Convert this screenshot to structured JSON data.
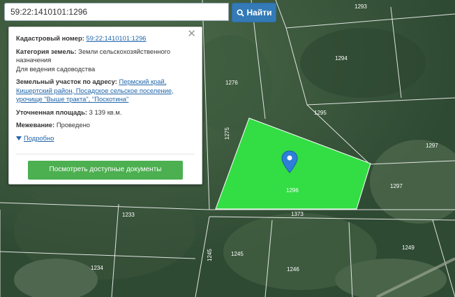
{
  "search": {
    "value": "59:22:1410101:1296",
    "button_label": "Найти"
  },
  "popup": {
    "cadastral_label": "Кадастровый номер:",
    "cadastral_value": "59:22:1410101:1296",
    "category_label": "Категория земель:",
    "category_value": "Земли сельскохозяйственного назначения",
    "usage_value": "Для ведения садоводства",
    "address_label": "Земельный участок по адресу:",
    "address_value": "Пермский край, Кишертский район, Посадское сельское поселение, урочище \"Выше тракта\", \"Поскотина\"",
    "area_label": "Уточненная площадь:",
    "area_value": "3 139 кв.м.",
    "survey_label": "Межевание:",
    "survey_value": "Проведено",
    "more_label": "Подробно",
    "docs_button": "Посмотреть доступные документы"
  },
  "map": {
    "parcel_labels": [
      "1293",
      "1294",
      "1276",
      "1295",
      "1297",
      "1275",
      "1296",
      "1297",
      "1233",
      "1373",
      "1249",
      "1245",
      "1245",
      "1246",
      "1234"
    ],
    "selected_parcel_color": "#33dd44",
    "parcel_line_color": "#ffffff"
  },
  "colors": {
    "accent": "#337ab7",
    "docs_button": "#4caf50",
    "marker": "#2d7fd8"
  }
}
